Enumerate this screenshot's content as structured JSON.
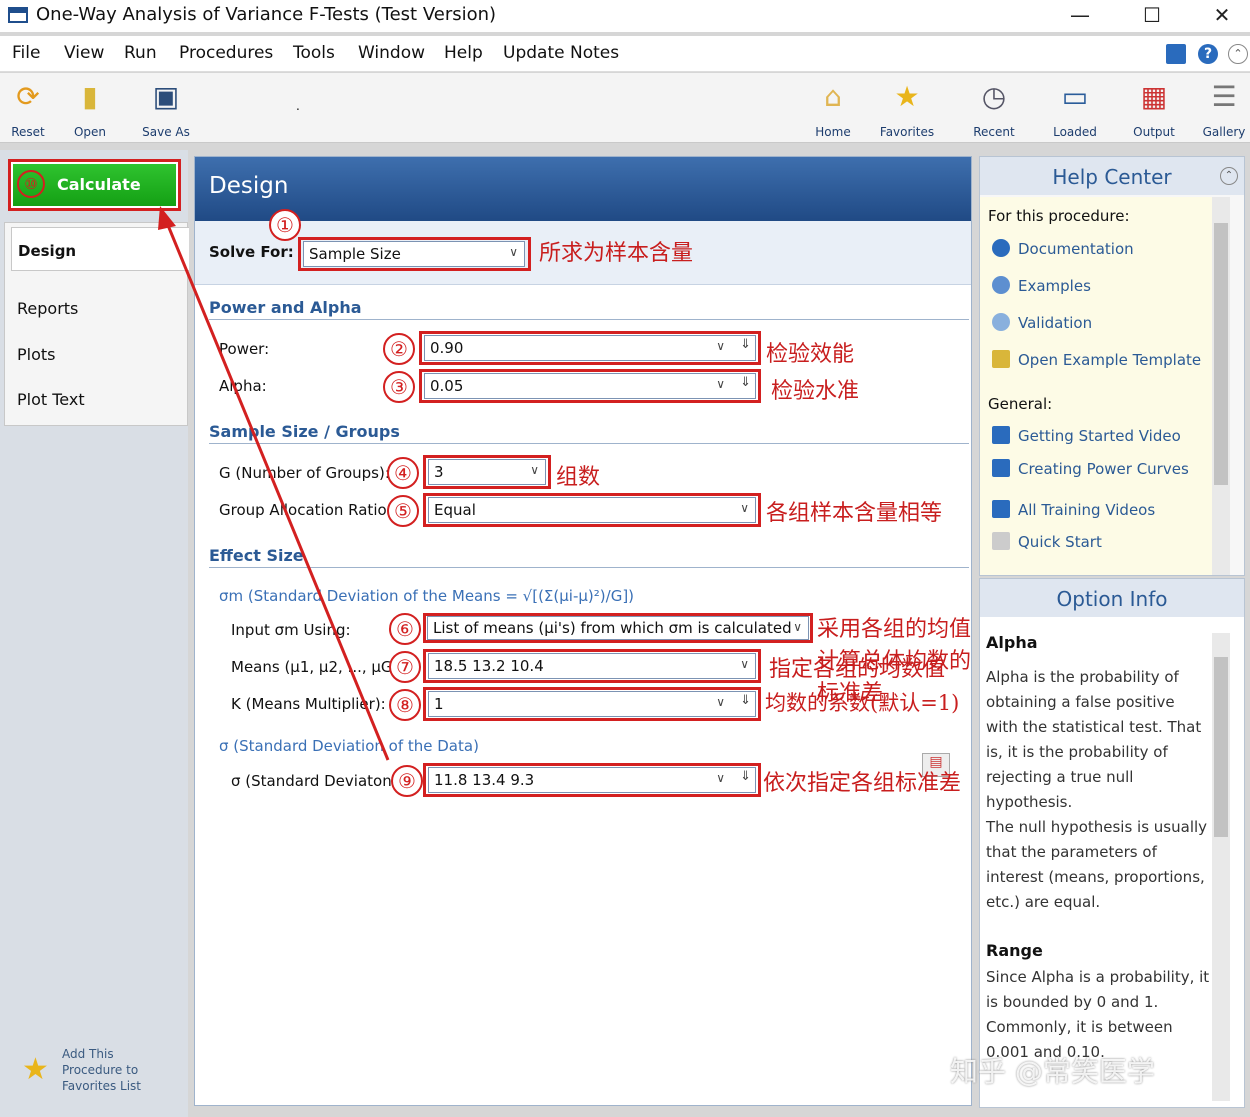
{
  "window": {
    "title": "One-Way Analysis of Variance F-Tests (Test Version)",
    "minimize": "—",
    "maximize": "☐",
    "close": "✕"
  },
  "menu": [
    {
      "label": "File"
    },
    {
      "label": "View"
    },
    {
      "label": "Run"
    },
    {
      "label": "Procedures"
    },
    {
      "label": "Tools"
    },
    {
      "label": "Window"
    },
    {
      "label": "Help"
    },
    {
      "label": "Update Notes"
    }
  ],
  "toolbar": {
    "reset": "Reset",
    "open": "Open",
    "save_as": "Save As",
    "dot": ".",
    "home": "Home",
    "favorites": "Favorites",
    "recent": "Recent",
    "loaded": "Loaded",
    "output": "Output",
    "gallery": "Gallery"
  },
  "left": {
    "calculate": "Calculate",
    "calc_num": "⑩",
    "nav": [
      "Design",
      "Reports",
      "Plots",
      "Plot Text"
    ],
    "favorites": "Add This Procedure to Favorites List"
  },
  "design": {
    "header": "Design",
    "solve_for_label": "Solve For:",
    "solve_for_value": "Sample Size",
    "solve_note": "所求为样本含量",
    "power_alpha_title": "Power and Alpha",
    "power_label": "Power:",
    "power_value": "0.90",
    "power_note": "检验效能",
    "alpha_label": "Alpha:",
    "alpha_value": "0.05",
    "alpha_note": "检验水准",
    "sample_title": "Sample Size / Groups",
    "g_label": "G (Number of Groups):",
    "g_value": "3",
    "g_note": "组数",
    "ratio_label": "Group Allocation Ratios:",
    "ratio_value": "Equal",
    "ratio_note": "各组样本含量相等",
    "effect_title": "Effect Size",
    "sigma_m_title": "σm (Standard Deviation of the Means = √[(Σ(μi-μ)²)/G])",
    "input_label": "Input σm Using:",
    "input_value": "List of means (μi's) from which σm is calculated",
    "input_note": "采用各组的均值计算总体均数的标准差",
    "means_label": "Means (μ1, μ2, ..., μG):",
    "means_value": "18.5 13.2 10.4",
    "means_note": "指定各组的均数值",
    "k_label": "K (Means Multiplier):",
    "k_value": "1",
    "k_note": "均数的系数(默认=1)",
    "sigma_title": "σ (Standard Deviation of the Data)",
    "sigma_label": "σ (Standard Deviaton):",
    "sigma_value": "11.8 13.4 9.3",
    "sigma_note": "依次指定各组标准差",
    "circles": [
      "①",
      "②",
      "③",
      "④",
      "⑤",
      "⑥",
      "⑦",
      "⑧",
      "⑨"
    ]
  },
  "help": {
    "title": "Help Center",
    "for_proc": "For this procedure:",
    "items": [
      "Documentation",
      "Examples",
      "Validation",
      "Open Example Template"
    ],
    "general": "General:",
    "general_items": [
      "Getting Started Video",
      "Creating Power Curves",
      "All Training Videos",
      "Quick Start"
    ]
  },
  "option": {
    "title": "Option Info",
    "h1": "Alpha",
    "p1": "Alpha is the probability of obtaining a false positive with the statistical test. That is, it is the probability of rejecting a true null hypothesis.",
    "p2": "The null hypothesis is usually that the parameters of interest (means, proportions, etc.) are equal.",
    "h2": "Range",
    "p3": "Since Alpha is a probability, it is bounded by 0 and 1. Commonly, it is between 0.001 and 0.10."
  },
  "watermark": "知乎 @常笑医学",
  "colors": {
    "accent": "#2b5a95",
    "annotation": "#d32020",
    "calculate": "#1cab1c"
  }
}
